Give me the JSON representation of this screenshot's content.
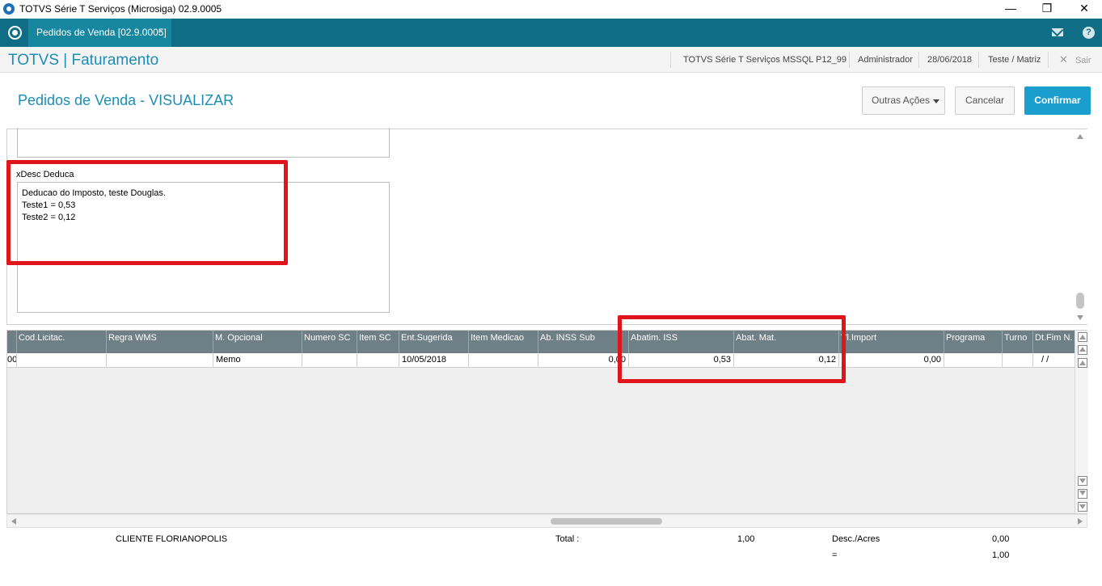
{
  "window": {
    "title": "TOTVS Série T Serviços (Microsiga) 02.9.0005",
    "minimize_glyph": "—",
    "maximize_glyph": "❐",
    "close_glyph": "✕"
  },
  "tabs": [
    {
      "label": "Pedidos de Venda [02.9.0005]",
      "close_glyph": "×"
    }
  ],
  "header": {
    "brand": "TOTVS | Faturamento",
    "environment": "TOTVS Série T Serviços MSSQL P12_99",
    "user": "Administrador",
    "date": "28/06/2018",
    "branch": "Teste / Matriz",
    "exit_label": "Sair"
  },
  "page": {
    "title": "Pedidos de Venda - VISUALIZAR",
    "buttons": {
      "more_actions": "Outras Ações",
      "cancel": "Cancelar",
      "confirm": "Confirmar"
    }
  },
  "form": {
    "memo_label": "xDesc Deduca",
    "memo_lines": [
      "Deducao do Imposto, teste Douglas.",
      "Teste1 = 0,53",
      "Teste2 = 0,12"
    ]
  },
  "grid": {
    "columns": [
      "",
      "Cod.Licitac.",
      "Regra WMS",
      "M. Opcional",
      "Numero SC",
      "Item SC",
      "Ent.Sugerida",
      "Item Medicao",
      "Ab. INSS Sub",
      "Abatim. ISS",
      "Abat. Mat.",
      "Vl.Import",
      "Programa",
      "Turno",
      "Dt.Fim N. P."
    ],
    "rows": [
      [
        "00",
        "",
        "",
        "Memo",
        "",
        "",
        "10/05/2018",
        "",
        "0,00",
        "0,53",
        "0,12",
        "0,00",
        "",
        "",
        "/ /"
      ]
    ]
  },
  "footer": {
    "client": "CLIENTE FLORIANOPOLIS",
    "total_label": "Total :",
    "total_value": "1,00",
    "desc_label": "Desc./Acres",
    "desc_value": "0,00",
    "eq_label": "=",
    "eq_value": "1,00"
  },
  "colors": {
    "tabbar": "#0f6e86",
    "accent": "#1d8db4",
    "confirm_button": "#1a9ecd",
    "grid_header": "#6f7f86",
    "highlight": "#e0141b"
  }
}
